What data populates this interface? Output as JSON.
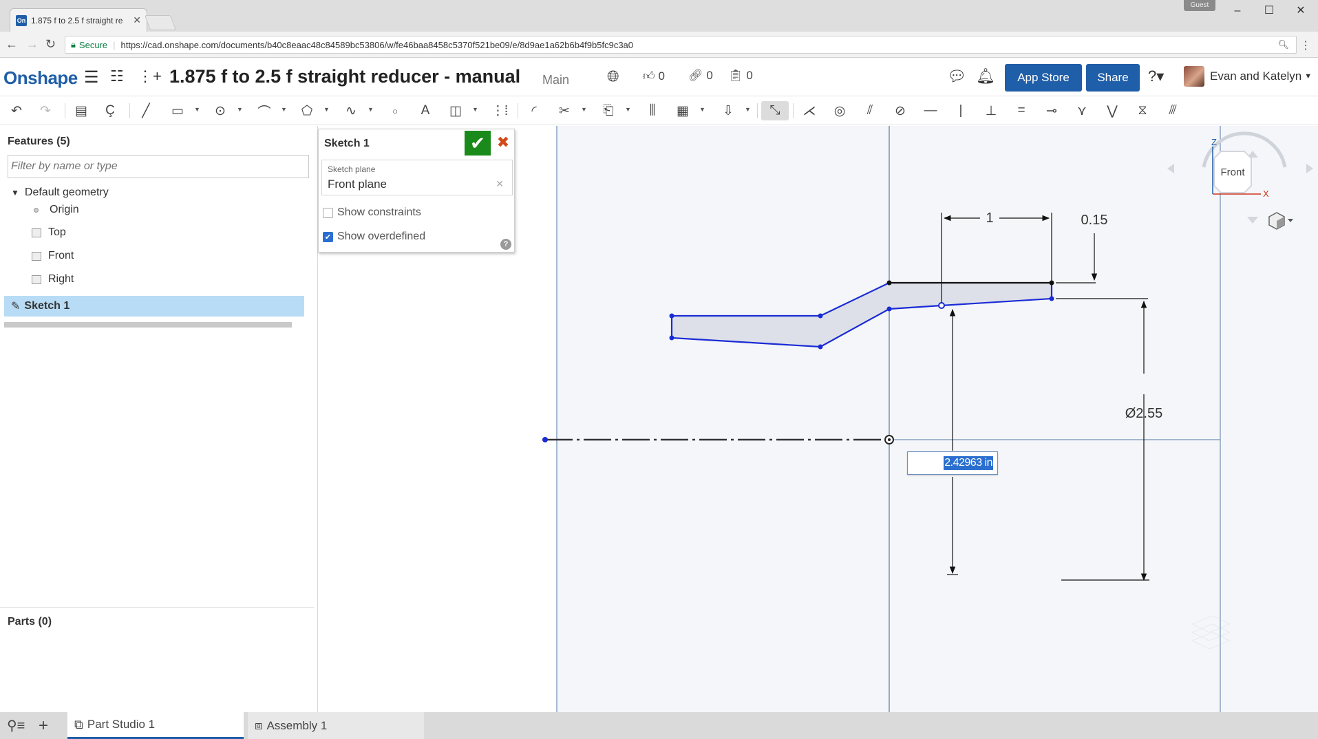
{
  "browser": {
    "tab_title": "1.875 f to 2.5 f straight re",
    "tab_favicon": "On",
    "guest_label": "Guest",
    "security_label": "Secure",
    "url": "https://cad.onshape.com/documents/b40c8eaac48c84589bc53806/w/fe46baa8458c5370f521be09/e/8d9ae1a62b6b4f9b5fc9c3a0"
  },
  "header": {
    "logo": "Onshape",
    "doc_title": "1.875 f to 2.5 f straight reducer - manual",
    "branch": "Main",
    "likes": "0",
    "links": "0",
    "copies": "0",
    "app_store_label": "App Store",
    "share_label": "Share",
    "user_name": "Evan and Katelyn"
  },
  "features": {
    "heading": "Features (5)",
    "filter_placeholder": "Filter by name or type",
    "default_geometry": "Default geometry",
    "items": [
      "Origin",
      "Top",
      "Front",
      "Right"
    ],
    "sketch": "Sketch 1",
    "parts_heading": "Parts (0)"
  },
  "dialog": {
    "title": "Sketch 1",
    "plane_label": "Sketch plane",
    "plane_value": "Front plane",
    "show_constraints": "Show constraints",
    "show_constraints_checked": false,
    "show_overdefined": "Show overdefined",
    "show_overdefined_checked": true
  },
  "sketch": {
    "dim_length": "1",
    "dim_thickness": "0.15",
    "dim_diameter": "Ø2.55",
    "dim_input_value": "2.42963 in"
  },
  "view_cube": {
    "face": "Front",
    "axis_z": "Z",
    "axis_x": "X"
  },
  "bottom_tabs": {
    "part_studio": "Part Studio 1",
    "assembly": "Assembly 1"
  },
  "colors": {
    "brand_blue": "#1f5ea8",
    "sketch_blue": "#1a2bd6",
    "selection": "#b8dcf5",
    "ok_green": "#1a8a1a"
  }
}
